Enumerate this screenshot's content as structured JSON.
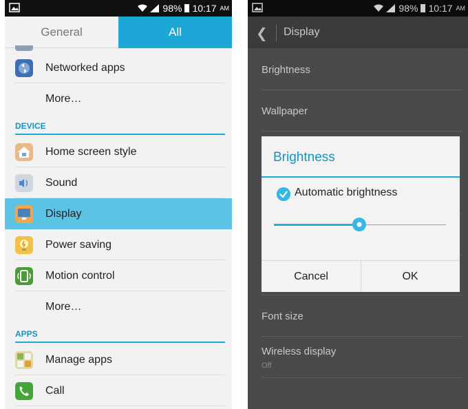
{
  "left_screen": {
    "status": {
      "battery": "98%",
      "time": "10:17",
      "ampm": "AM"
    },
    "tabs": [
      {
        "label": "General"
      },
      {
        "label": "All"
      }
    ],
    "items": {
      "networked_apps": "Networked apps",
      "more_1": "More…",
      "section_device": "DEVICE",
      "home_screen_style": "Home screen style",
      "sound": "Sound",
      "display": "Display",
      "power_saving": "Power saving",
      "motion_control": "Motion control",
      "more_2": "More…",
      "section_apps": "APPS",
      "manage_apps": "Manage apps",
      "call": "Call"
    }
  },
  "right_screen": {
    "status": {
      "battery": "98%",
      "time": "10:17",
      "ampm": "AM"
    },
    "action_bar": {
      "title": "Display"
    },
    "items": {
      "brightness": "Brightness",
      "wallpaper": "Wallpaper",
      "font_size": "Font size",
      "wireless_display": "Wireless display",
      "wireless_display_sub": "Off"
    },
    "dialog": {
      "title": "Brightness",
      "checkbox_label": "Automatic brightness",
      "checkbox_checked": true,
      "slider_level": 0.5,
      "cancel": "Cancel",
      "ok": "OK"
    }
  },
  "colors": {
    "accent": "#1da7d6",
    "selected": "#5dc3e5"
  }
}
